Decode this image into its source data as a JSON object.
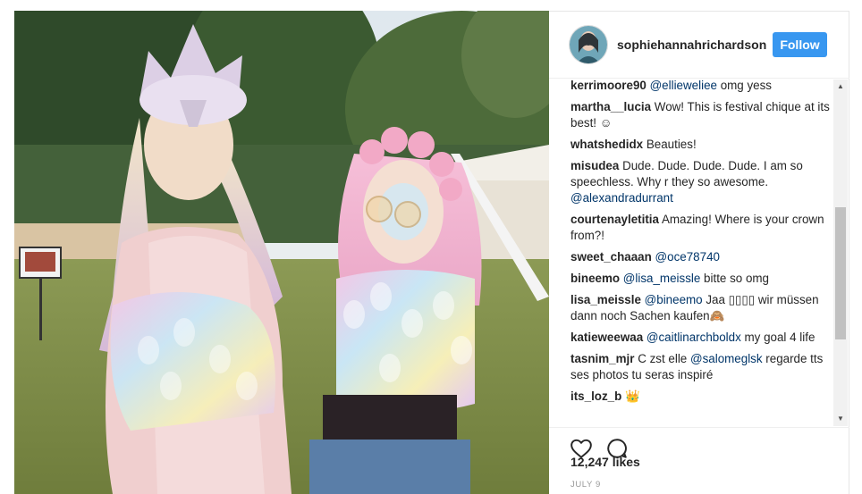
{
  "post": {
    "username": "sophiehannahrichardson",
    "follow_label": "Follow",
    "likes": "12,247 likes",
    "date": "JULY 9"
  },
  "comments": [
    {
      "user": "kerrimoore90",
      "parts": [
        {
          "t": "mention",
          "v": "@ellieweliee"
        },
        {
          "t": "text",
          "v": " omg yess"
        }
      ]
    },
    {
      "user": "martha__lucia",
      "parts": [
        {
          "t": "text",
          "v": "Wow! This is festival chique at its best! ☺"
        }
      ]
    },
    {
      "user": "whatshedidx",
      "parts": [
        {
          "t": "text",
          "v": "Beauties!"
        }
      ]
    },
    {
      "user": "misudea",
      "parts": [
        {
          "t": "text",
          "v": "Dude. Dude. Dude. Dude. I am so speechless. Why r they so awesome. "
        },
        {
          "t": "mention",
          "v": "@alexandradurrant"
        }
      ]
    },
    {
      "user": "courtenayletitia",
      "parts": [
        {
          "t": "text",
          "v": "Amazing! Where is your crown from?!"
        }
      ]
    },
    {
      "user": "sweet_chaaan",
      "parts": [
        {
          "t": "mention",
          "v": "@oce78740"
        }
      ]
    },
    {
      "user": "bineemo",
      "parts": [
        {
          "t": "mention",
          "v": "@lisa_meissle"
        },
        {
          "t": "text",
          "v": " bitte so omg"
        }
      ]
    },
    {
      "user": "lisa_meissle",
      "parts": [
        {
          "t": "mention",
          "v": "@bineemo"
        },
        {
          "t": "text",
          "v": " Jaa ▯▯▯▯ wir müssen dann noch Sachen kaufen🙈"
        }
      ]
    },
    {
      "user": "katieweewaa",
      "parts": [
        {
          "t": "mention",
          "v": "@caitlinarchboldx"
        },
        {
          "t": "text",
          "v": " my goal 4 life"
        }
      ]
    },
    {
      "user": "tasnim_mjr",
      "parts": [
        {
          "t": "text",
          "v": "C zst elle "
        },
        {
          "t": "mention",
          "v": "@salomeglsk"
        },
        {
          "t": "text",
          "v": " regarde tts ses photos tu seras inspiré"
        }
      ]
    },
    {
      "user": "its_loz_b",
      "parts": [
        {
          "t": "text",
          "v": "👑"
        }
      ]
    }
  ],
  "icons": {
    "like": "heart-icon",
    "comment": "comment-icon",
    "scroll_up": "scroll-up-arrow",
    "scroll_down": "scroll-down-arrow"
  },
  "colors": {
    "follow_button": "#3897f0",
    "mention": "#003569",
    "date": "#999999"
  }
}
